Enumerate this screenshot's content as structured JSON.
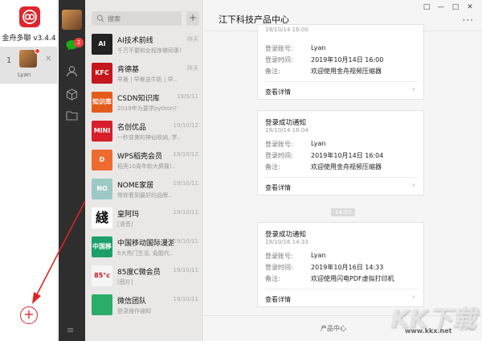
{
  "app": {
    "name": "金舟多聊 v3.4.4",
    "account": {
      "index": "1",
      "name": "Lyan",
      "close_glyph": "✕",
      "avatar_icon": "user-avatar"
    },
    "add_account_glyph": "+"
  },
  "nav": {
    "unread_badge": "2",
    "icons": [
      "chat-icon",
      "contacts-icon",
      "box-icon",
      "folder-icon",
      "menu-icon"
    ],
    "menu_glyph": "≡"
  },
  "chat_list": {
    "search_placeholder": "搜索",
    "add_glyph": "+",
    "items": [
      {
        "name": "AI技术前线",
        "date": "昨天",
        "preview": "千万不要和女程序做同事!",
        "avatar_text": "AI",
        "avatar_color": "#222222"
      },
      {
        "name": "肯德基",
        "date": "昨天",
        "preview": "早餐 | 早餐送牛奶 | 早..",
        "avatar_text": "KFC",
        "avatar_color": "#c4161c"
      },
      {
        "name": "CSDN知识库",
        "date": "19/9/11",
        "preview": "2019年为要学python?",
        "avatar_text": "知识库",
        "avatar_color": "#e35b1b"
      },
      {
        "name": "名创优品",
        "date": "19/10/12",
        "preview": "一秒变美的神仙收纳, 学..",
        "avatar_text": "MINI SO",
        "avatar_color": "#d71e2a"
      },
      {
        "name": "WPS稻壳会员",
        "date": "19/10/12",
        "preview": "稻壳10周年和大屏展!..",
        "avatar_text": "D",
        "avatar_color": "#ee6b2f"
      },
      {
        "name": "NOME家居",
        "date": "19/10/11",
        "preview": "带你看到最好的品牌..",
        "avatar_text": "NO ME",
        "avatar_color": "#9cc9c4"
      },
      {
        "name": "皇阿玛",
        "date": "19/10/11",
        "preview": "[语音]",
        "avatar_text": "綫",
        "avatar_color": "#ffffff"
      },
      {
        "name": "中国移动国际漫游",
        "date": "19/10/11",
        "preview": "6大热门生活, 竟能代..",
        "avatar_text": "中国移动",
        "avatar_color": "#1aa068"
      },
      {
        "name": "85度C微会员",
        "date": "19/10/11",
        "preview": "[图片]",
        "avatar_text": "85°c",
        "avatar_color": "#f6f6f6"
      },
      {
        "name": "微信团队",
        "date": "19/10/11",
        "preview": "登录操作通知",
        "avatar_text": "",
        "avatar_color": "#2aae67"
      }
    ]
  },
  "window": {
    "controls": [
      "□",
      "—",
      "□",
      "✕"
    ],
    "more_glyph": "···"
  },
  "conversation": {
    "title": "江下科技产品中心",
    "cards": [
      {
        "title": "",
        "date": "19/10/14 16:00",
        "rows": [
          {
            "label": "登录账号:",
            "value": "Lyan"
          },
          {
            "label": "登录时间:",
            "value": "2019年10月14日 16:00"
          },
          {
            "label": "备注:",
            "value": "欢迎使用金舟视频压缩器"
          }
        ],
        "link": "查看详情"
      },
      {
        "title": "登录成功通知",
        "date": "19/10/14 16:04",
        "rows": [
          {
            "label": "登录账号:",
            "value": "Lyan"
          },
          {
            "label": "登录时间:",
            "value": "2019年10月14日 16:04"
          },
          {
            "label": "备注:",
            "value": "欢迎使用金舟视频压缩器"
          }
        ],
        "link": "查看详情"
      },
      {
        "title": "登录成功通知",
        "date": "19/10/16 14:33",
        "rows": [
          {
            "label": "登录账号:",
            "value": "Lyan"
          },
          {
            "label": "登录时间:",
            "value": "2019年10月16日 14:33"
          },
          {
            "label": "备注:",
            "value": "欢迎使用闪电PDF虚拟打印机"
          }
        ],
        "link": "查看详情"
      }
    ],
    "time_divider": "14:33",
    "chevron_glyph": "›",
    "footer": "产品中心",
    "footer_glyph": "·≡"
  },
  "watermark": {
    "logo": "KK下载",
    "url": "www.kkx.net"
  },
  "colors": {
    "brand_red": "#e0262d",
    "nav_dark": "#2e2e2e",
    "annotation_red": "#e02424",
    "badge": "#f34141"
  }
}
